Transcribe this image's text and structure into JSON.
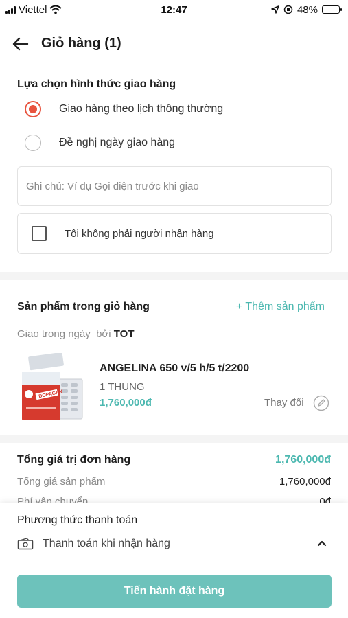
{
  "status_bar": {
    "carrier": "Viettel",
    "time": "12:47",
    "battery": "48%",
    "battery_level": 0.48
  },
  "header": {
    "title": "Giỏ hàng (1)"
  },
  "delivery": {
    "title": "Lựa chọn hình thức giao hàng",
    "options": [
      {
        "label": "Giao hàng theo lịch thông thường",
        "selected": true
      },
      {
        "label": "Đề nghị ngày giao hàng",
        "selected": false
      }
    ],
    "note_placeholder": "Ghi chú: Ví dụ Gọi điện trước khi giao",
    "not_receiver_label": "Tôi không phải người nhận hàng"
  },
  "cart": {
    "title": "Sản phẩm trong giỏ hàng",
    "add_label": "+ Thêm sản phẩm",
    "delivery_note": "Giao trong ngày",
    "by_label": "bởi",
    "seller": "TOT",
    "item": {
      "name": "ANGELINA 650 v/5 h/5 t/2200",
      "unit": "1 THUNG",
      "price": "1,760,000đ",
      "change_label": "Thay đổi",
      "image_brand": "DOPAGAN"
    }
  },
  "summary": {
    "title": "Tổng giá trị đơn hàng",
    "total": "1,760,000đ",
    "rows": [
      {
        "label": "Tổng giá sản phẩm",
        "value": "1,760,000đ"
      },
      {
        "label": "Phí vận chuyển",
        "value": "0đ"
      }
    ]
  },
  "payment": {
    "title": "Phương thức thanh toán",
    "method": "Thanh toán khi nhận hàng",
    "button_label": "Tiến hành đặt hàng"
  },
  "colors": {
    "accent": "#4cb8b0",
    "radio": "#e8543f",
    "button": "#6dc2bb"
  }
}
